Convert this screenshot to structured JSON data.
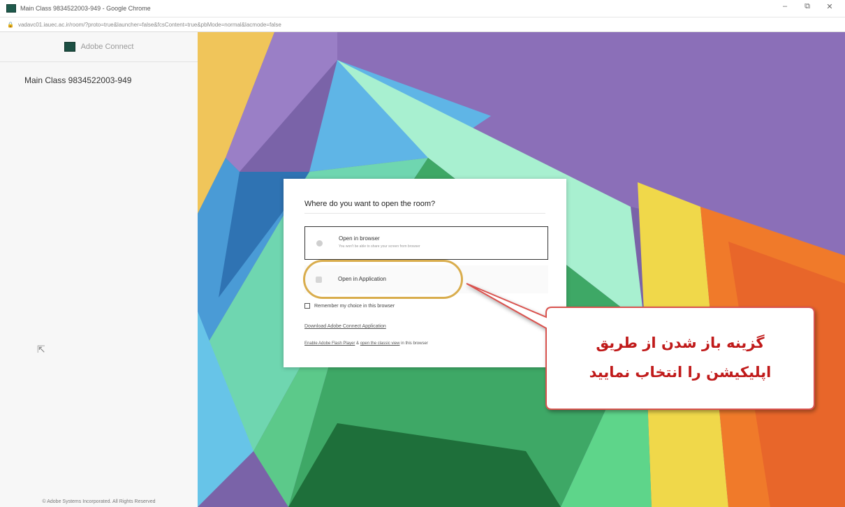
{
  "window": {
    "title": "Main Class 9834522003-949 - Google Chrome",
    "controls": {
      "minimize": "–",
      "maximize": "⧉",
      "close": "✕"
    }
  },
  "address_bar": {
    "url": "vadavc01.iauec.ac.ir/room/?proto=true&launcher=false&fcsContent=true&pbMode=normal&lacmode=false"
  },
  "sidebar": {
    "brand": "Adobe Connect",
    "room_title": "Main Class 9834522003-949",
    "footer": "© Adobe Systems Incorporated. All Rights Reserved"
  },
  "dialog": {
    "title": "Where do you want to open the room?",
    "option_browser": {
      "label": "Open in browser",
      "subtitle": "You won't be able to share your screen from browser"
    },
    "option_app": {
      "label": "Open in Application"
    },
    "remember_label": "Remember my choice in this browser",
    "download_link": "Download Adobe Connect Application",
    "flash_link": "Enable Adobe Flash Player",
    "flash_mid": " & ",
    "classic_link": "open the classic view",
    "flash_end": " in this browser"
  },
  "callout": {
    "line1": "گزینه باز شدن از طریق",
    "line2": "اپلیکیشن را انتخاب نمایید",
    "text_color": "#c01a1a",
    "border_color": "#d9534f",
    "highlight_color": "#d9ad4d"
  }
}
